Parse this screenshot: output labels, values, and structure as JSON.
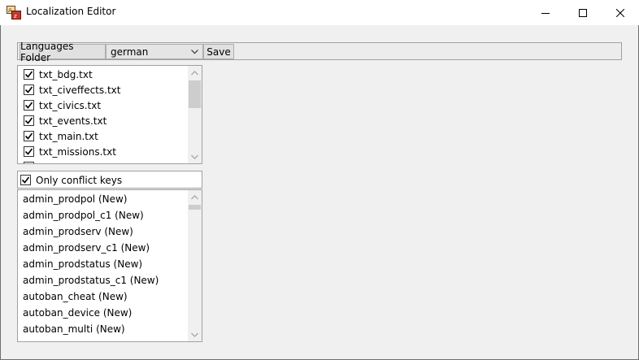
{
  "window": {
    "title": "Localization Editor"
  },
  "toolbar": {
    "languages_folder_label": "Languages Folder",
    "language_selected": "german",
    "save_label": "Save"
  },
  "files": {
    "items": [
      {
        "label": "txt_bdg.txt",
        "checked": true
      },
      {
        "label": "txt_civeffects.txt",
        "checked": true
      },
      {
        "label": "txt_civics.txt",
        "checked": true
      },
      {
        "label": "txt_events.txt",
        "checked": true
      },
      {
        "label": "txt_main.txt",
        "checked": true
      },
      {
        "label": "txt_missions.txt",
        "checked": true
      }
    ],
    "scroll_position": 0.0
  },
  "filter": {
    "only_conflict_label": "Only conflict keys",
    "only_conflict_checked": true
  },
  "keys": {
    "items": [
      "admin_prodpol (New)",
      "admin_prodpol_c1 (New)",
      "admin_prodserv (New)",
      "admin_prodserv_c1 (New)",
      "admin_prodstatus (New)",
      "admin_prodstatus_c1 (New)",
      "autoban_cheat (New)",
      "autoban_device (New)",
      "autoban_multi (New)"
    ]
  },
  "colors": {
    "window_bg": "#f0f0f0",
    "titlebar_bg": "#ffffff",
    "button_bg": "#e1e1e1",
    "border": "#a0a0a0",
    "scroll_thumb": "#cdcdcd"
  }
}
